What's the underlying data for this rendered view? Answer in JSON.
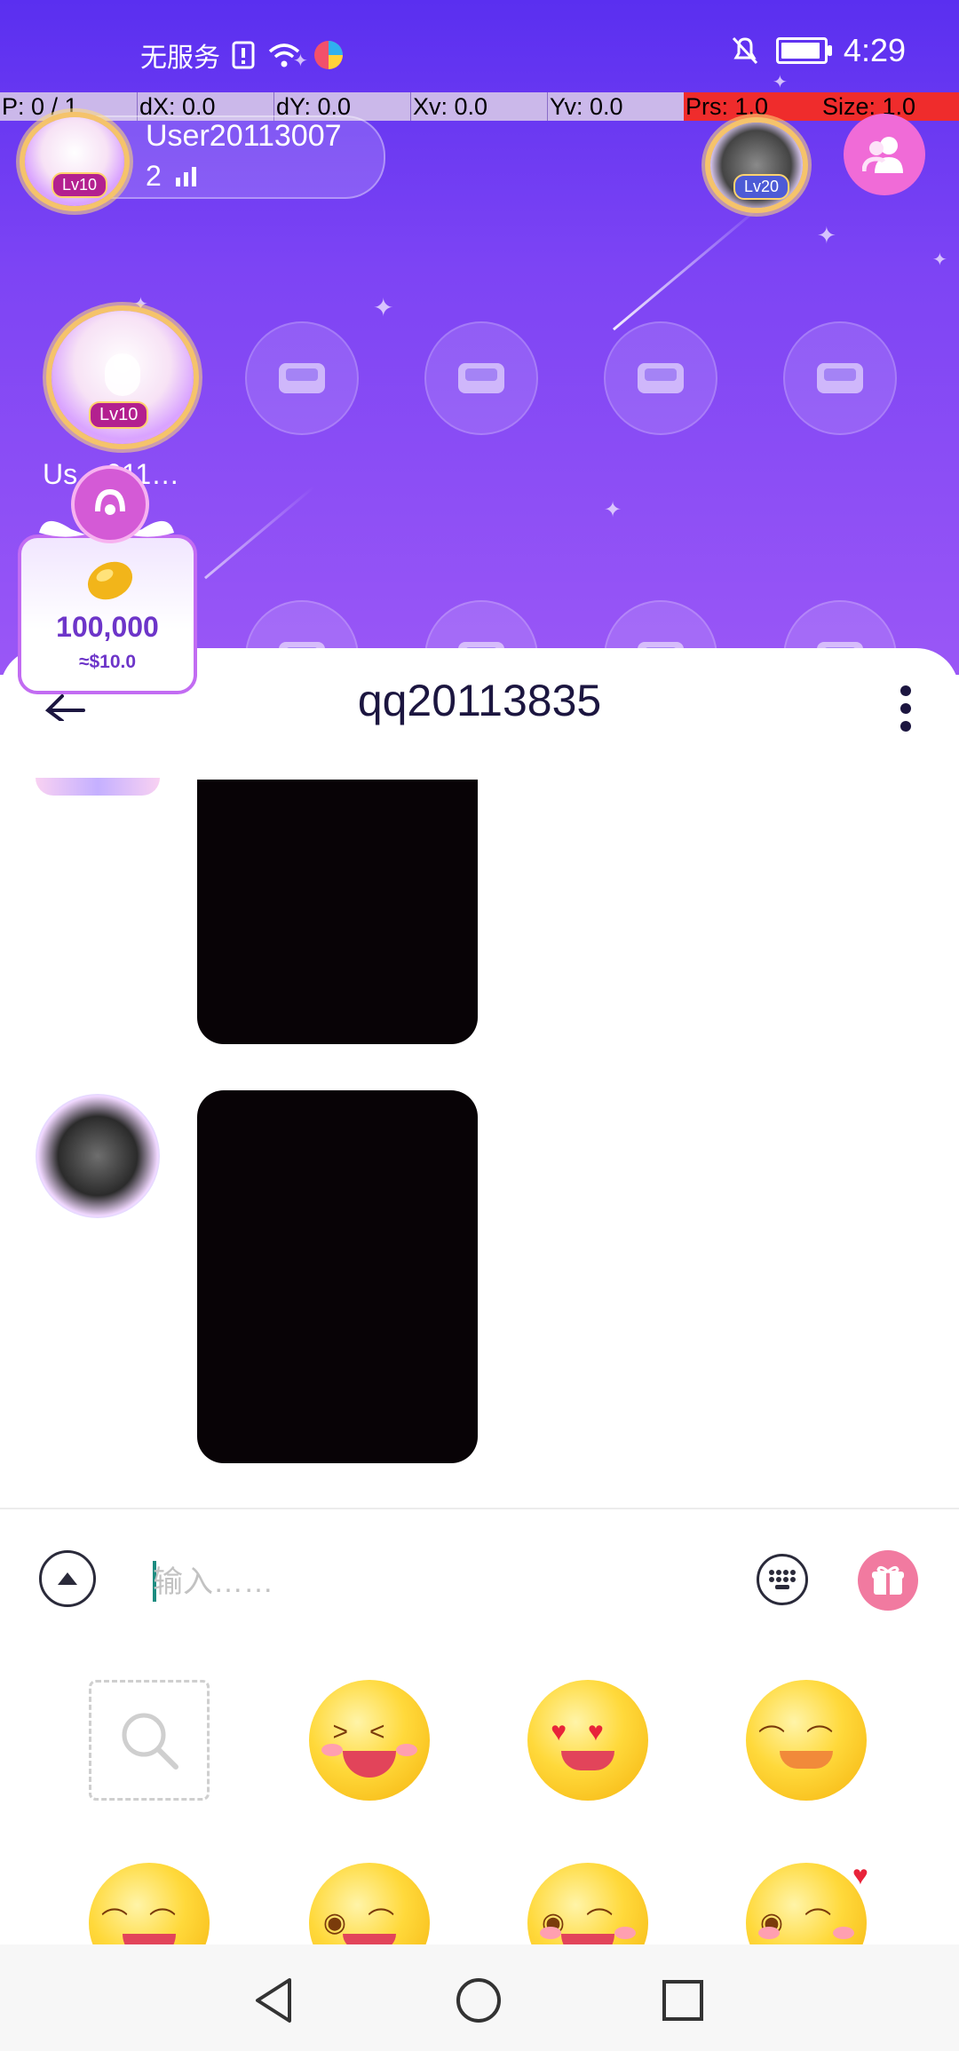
{
  "status_bar": {
    "carrier": "无服务",
    "time": "4:29"
  },
  "debug_overlay": {
    "p": "P: 0 / 1",
    "dx": "dX: 0.0",
    "dy": "dY: 0.0",
    "xv": "Xv: 0.0",
    "yv": "Yv: 0.0",
    "prs": "Prs: 1.0",
    "size": "Size: 1.0"
  },
  "room_header": {
    "host_name": "User20113007",
    "host_level": "Lv10",
    "online_count": "2",
    "guest_level": "Lv20"
  },
  "mic_seat": {
    "user_label": "Us…011…",
    "level": "Lv10"
  },
  "coin_card": {
    "value": "100,000",
    "usd": "≈$10.0"
  },
  "chat": {
    "title": "qq20113835"
  },
  "input": {
    "placeholder": "输入……"
  },
  "colors": {
    "hero_top": "#5a2ff0",
    "hero_bottom": "#9a57f6",
    "accent_pink": "#f17aa0",
    "text_dark": "#1c1640"
  },
  "emoji_panel": {
    "icons": [
      "search-icon",
      "laughing-emoji",
      "heart-eyes-emoji",
      "smiling-emoji",
      "tears-of-joy-emoji",
      "toast-emoji",
      "wink-emoji",
      "winking-heart-emoji"
    ]
  }
}
